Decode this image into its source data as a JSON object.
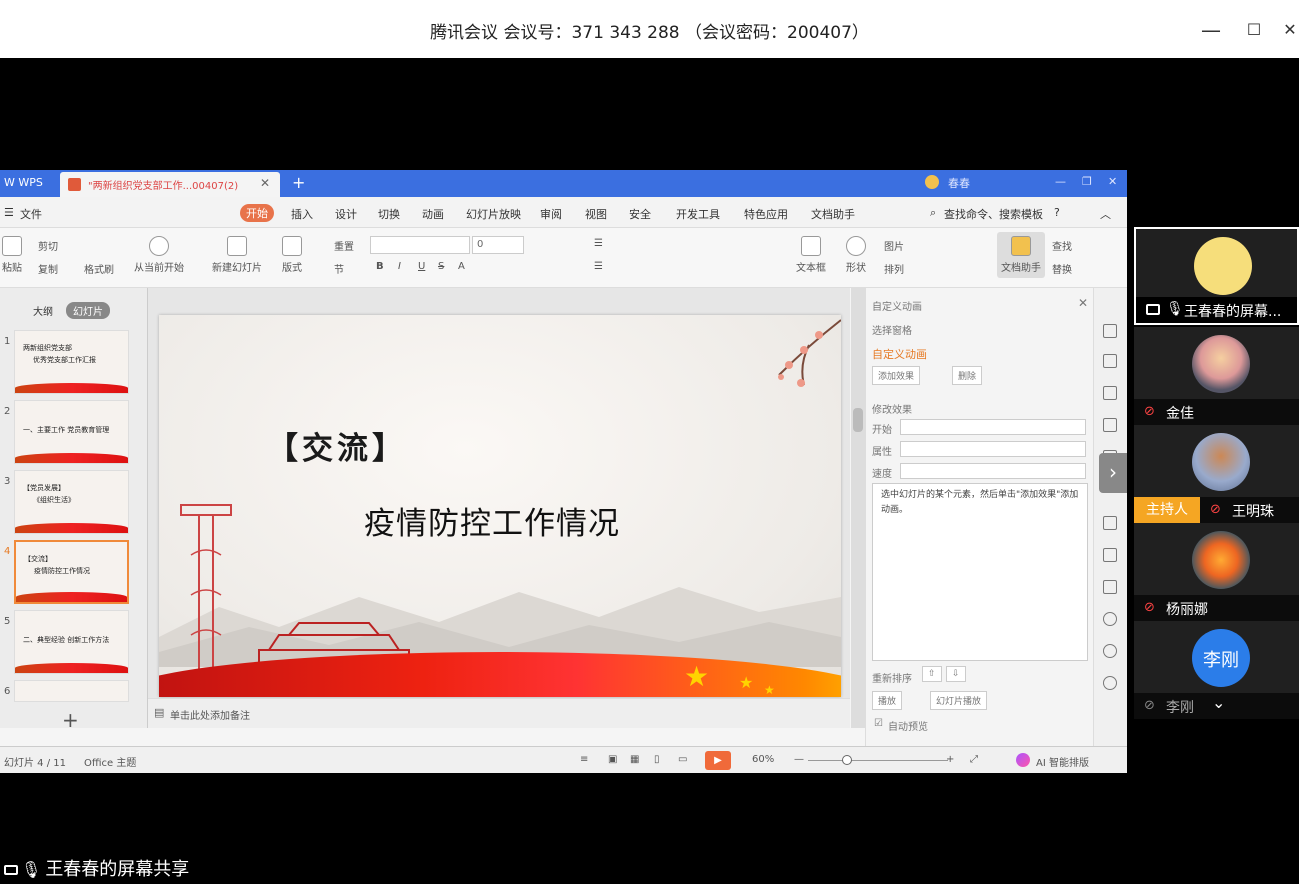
{
  "window": {
    "title": "腾讯会议 会议号：371 343 288 （会议密码：200407）",
    "controls": {
      "minimize": "—",
      "maximize": "☐",
      "close": "✕"
    }
  },
  "wps": {
    "brand": "W WPS",
    "doc_tab_title": "\"两新组织党支部工作...00407(2)",
    "tab_close": "✕",
    "tab_plus": "+",
    "tab_right_user": "春春",
    "menu": [
      "文件",
      "开始",
      "插入",
      "设计",
      "切换",
      "动画",
      "幻灯片放映",
      "审阅",
      "视图",
      "安全",
      "开发工具",
      "特色应用",
      "文档助手"
    ],
    "menu_active_index": 1,
    "search_text": "查找命令、搜索模板",
    "ribbon": {
      "paste": "粘贴",
      "cut": "剪切",
      "copy": "复制",
      "format_painter": "格式刷",
      "from_current": "从当前开始",
      "new_slide": "新建幻灯片",
      "layout": "版式",
      "section": "节",
      "reset": "重置",
      "font_size": "0",
      "text_box": "文本框",
      "shape": "形状",
      "picture": "图片",
      "arrange": "排列",
      "doc_helper": "文档助手",
      "find": "查找",
      "replace": "替换"
    },
    "left_panel": {
      "tab_outline": "大纲",
      "tab_slides": "幻灯片",
      "add": "+",
      "thumbs": [
        {
          "num": "1",
          "line1": "两新组织党支部",
          "line2": "优秀党支部工作汇报"
        },
        {
          "num": "2",
          "line1": "一、主要工作  党员教育管理",
          "line2": ""
        },
        {
          "num": "3",
          "line1": "【党员发展】",
          "line2": "《组织生活》"
        },
        {
          "num": "4",
          "line1": "【交流】",
          "line2": "疫情防控工作情况"
        },
        {
          "num": "5",
          "line1": "二、典型经验  创新工作方法",
          "line2": ""
        },
        {
          "num": "6",
          "line1": "",
          "line2": ""
        }
      ],
      "selected_index": 3
    },
    "slide": {
      "heading": "【交流】",
      "title": "疫情防控工作情况"
    },
    "notes_placeholder": "单击此处添加备注",
    "anim_panel": {
      "header": "自定义动画",
      "select_pane": "选择窗格",
      "custom_anim": "自定义动画",
      "add_effect": "添加效果",
      "delete": "删除",
      "modify_effect": "修改效果",
      "start_label": "开始",
      "property_label": "属性",
      "speed_label": "速度",
      "hint": "选中幻灯片的某个元素，然后单击\"添加效果\"添加动画。",
      "reorder": "重新排序",
      "play": "播放",
      "slideshow": "幻灯片播放",
      "autopreview": "自动预览"
    },
    "status": {
      "slide_info": "幻灯片 4 / 11",
      "theme": "Office 主题",
      "zoom": "60%",
      "ai": "AI 智能排版"
    }
  },
  "participants": [
    {
      "name": "王春春的屏幕...",
      "role": "presenter",
      "mic": "on"
    },
    {
      "name": "金佳",
      "role": "",
      "mic": "muted"
    },
    {
      "name": "王明珠",
      "role": "主持人",
      "mic": "muted"
    },
    {
      "name": "杨丽娜",
      "role": "",
      "mic": "muted"
    },
    {
      "name": "李刚",
      "role": "",
      "mic": "muted",
      "avatar_text": "李刚"
    }
  ],
  "share_label": "王春春的屏幕共享",
  "colors": {
    "wps_blue": "#3b6fe0",
    "wps_orange": "#e8734a",
    "host_badge": "#f5a623",
    "li_gang_avatar": "#2b7de9"
  }
}
